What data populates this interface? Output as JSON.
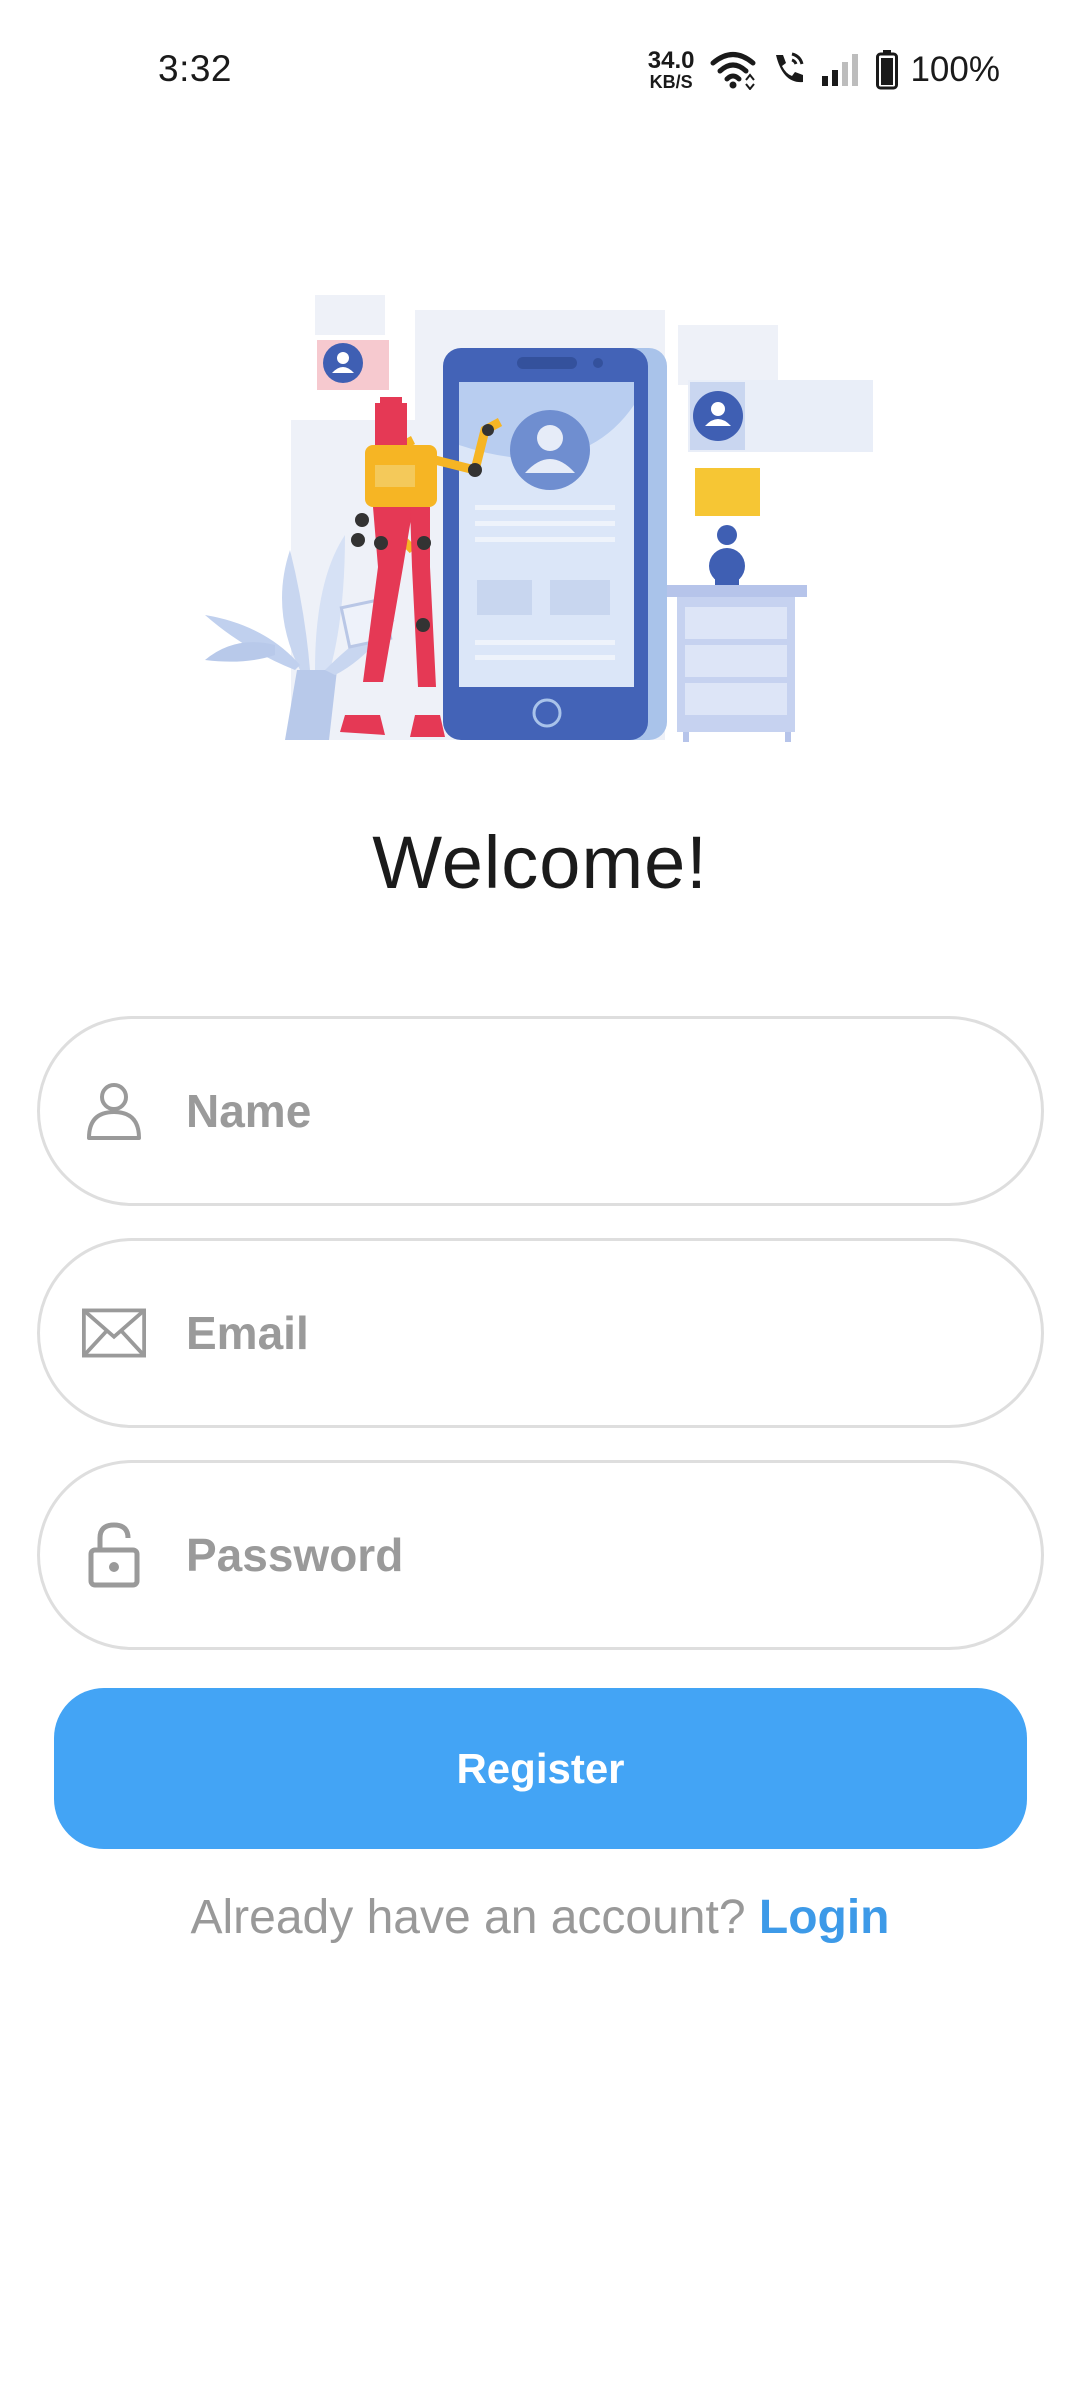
{
  "status_bar": {
    "time": "3:32",
    "net_speed_value": "34.0",
    "net_speed_unit": "KB/S",
    "battery": "100%"
  },
  "welcome_title": "Welcome!",
  "form": {
    "name_placeholder": "Name",
    "email_placeholder": "Email",
    "password_placeholder": "Password",
    "register_label": "Register"
  },
  "footer": {
    "prompt": "Already have an account?",
    "login_label": "Login"
  },
  "colors": {
    "accent": "#43a4f5",
    "link": "#3d9ae8",
    "border": "#dedede",
    "hint": "#9a9a9a"
  }
}
